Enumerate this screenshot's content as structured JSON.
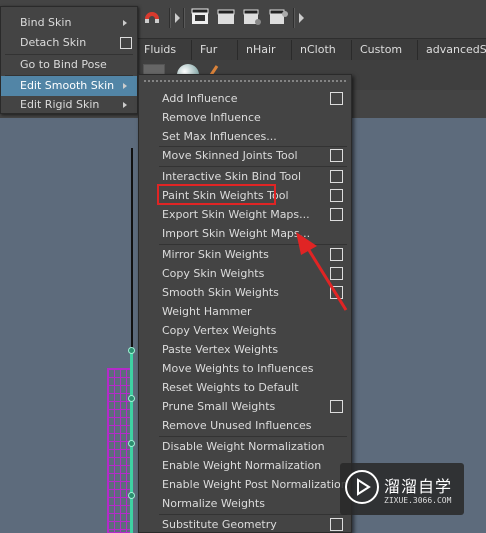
{
  "toolbar": {
    "icons": [
      "magnet-icon",
      "clapper-icon",
      "clapper-icon",
      "clapper-icon"
    ]
  },
  "shelf": {
    "tabs": [
      "Fluids",
      "Fur",
      "nHair",
      "nCloth",
      "Custom",
      "advancedSk"
    ]
  },
  "left_menu": {
    "items": [
      {
        "label": "Bind Skin",
        "submenu": true
      },
      {
        "label": "Detach Skin",
        "option": true
      },
      {
        "label": "Go to Bind Pose"
      },
      {
        "label": "Edit Smooth Skin",
        "submenu": true,
        "active": true
      },
      {
        "label": "Edit Rigid Skin",
        "submenu": true
      }
    ]
  },
  "submenu": {
    "items": [
      {
        "label": "Add Influence",
        "option": true
      },
      {
        "label": "Remove Influence"
      },
      {
        "label": "Set Max Influences..."
      },
      {
        "label": "Move Skinned Joints Tool",
        "option": true
      },
      {
        "label": "Interactive Skin Bind Tool",
        "option": true
      },
      {
        "label": "Paint Skin Weights Tool",
        "option": true,
        "highlighted": true
      },
      {
        "label": "Export Skin Weight Maps...",
        "option": true
      },
      {
        "label": "Import Skin Weight Maps..."
      },
      {
        "label": "Mirror Skin Weights",
        "option": true
      },
      {
        "label": "Copy Skin Weights",
        "option": true
      },
      {
        "label": "Smooth Skin Weights",
        "option": true
      },
      {
        "label": "Weight Hammer"
      },
      {
        "label": "Copy Vertex Weights"
      },
      {
        "label": "Paste Vertex Weights"
      },
      {
        "label": "Move Weights to Influences"
      },
      {
        "label": "Reset Weights to Default"
      },
      {
        "label": "Prune Small Weights",
        "option": true
      },
      {
        "label": "Remove Unused Influences"
      },
      {
        "label": "Disable Weight Normalization"
      },
      {
        "label": "Enable Weight Normalization"
      },
      {
        "label": "Enable Weight Post Normalization"
      },
      {
        "label": "Normalize Weights"
      },
      {
        "label": "Substitute Geometry",
        "option": true
      }
    ]
  },
  "annotation": {
    "highlight_color": "#e02424",
    "arrow_color": "#e02424"
  },
  "watermark": {
    "title": "溜溜自学",
    "subtitle": "ZIXUE.3066.COM"
  },
  "colors": {
    "menu_bg": "#444444",
    "active_item": "#5285a6",
    "viewport": "#5d6b7c",
    "joint": "#3ed1a3",
    "mesh": "#b42bc9"
  }
}
